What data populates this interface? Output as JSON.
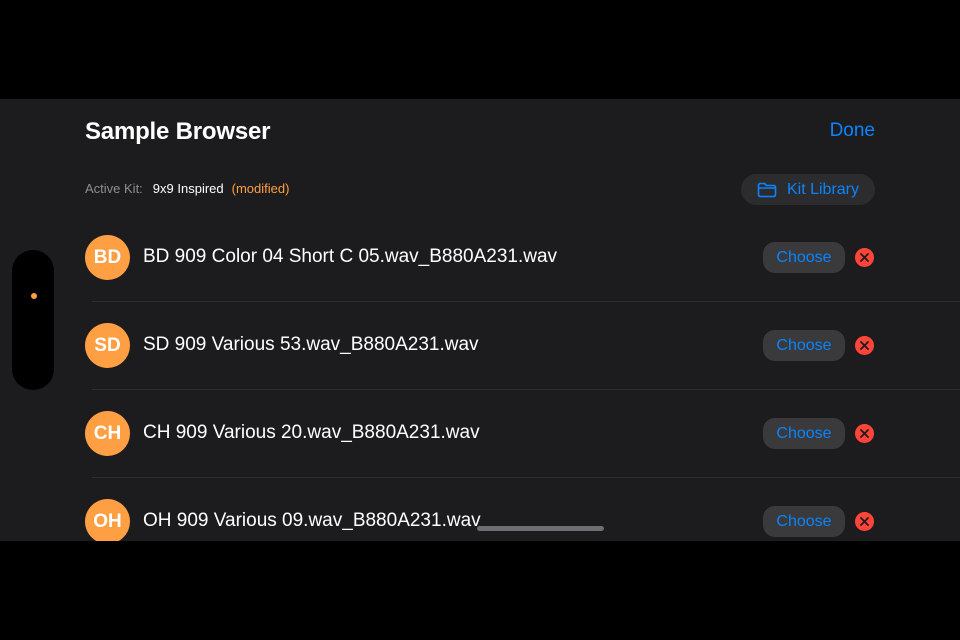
{
  "header": {
    "title": "Sample Browser",
    "done_label": "Done"
  },
  "kit": {
    "label": "Active Kit:",
    "name": "9x9 Inspired",
    "status": "(modified)",
    "library_label": "Kit Library",
    "library_icon": "folder-icon"
  },
  "samples": [
    {
      "badge": "BD",
      "name": "BD 909 Color 04 Short C 05.wav_B880A231.wav",
      "choose_label": "Choose"
    },
    {
      "badge": "SD",
      "name": "SD 909 Various 53.wav_B880A231.wav",
      "choose_label": "Choose"
    },
    {
      "badge": "CH",
      "name": "CH 909 Various 20.wav_B880A231.wav",
      "choose_label": "Choose"
    },
    {
      "badge": "OH",
      "name": "OH 909 Various 09.wav_B880A231.wav",
      "choose_label": "Choose"
    }
  ],
  "colors": {
    "accent": "#0a84ff",
    "badge": "#ff9f43",
    "remove": "#ff453a",
    "background": "#1c1c1e"
  }
}
